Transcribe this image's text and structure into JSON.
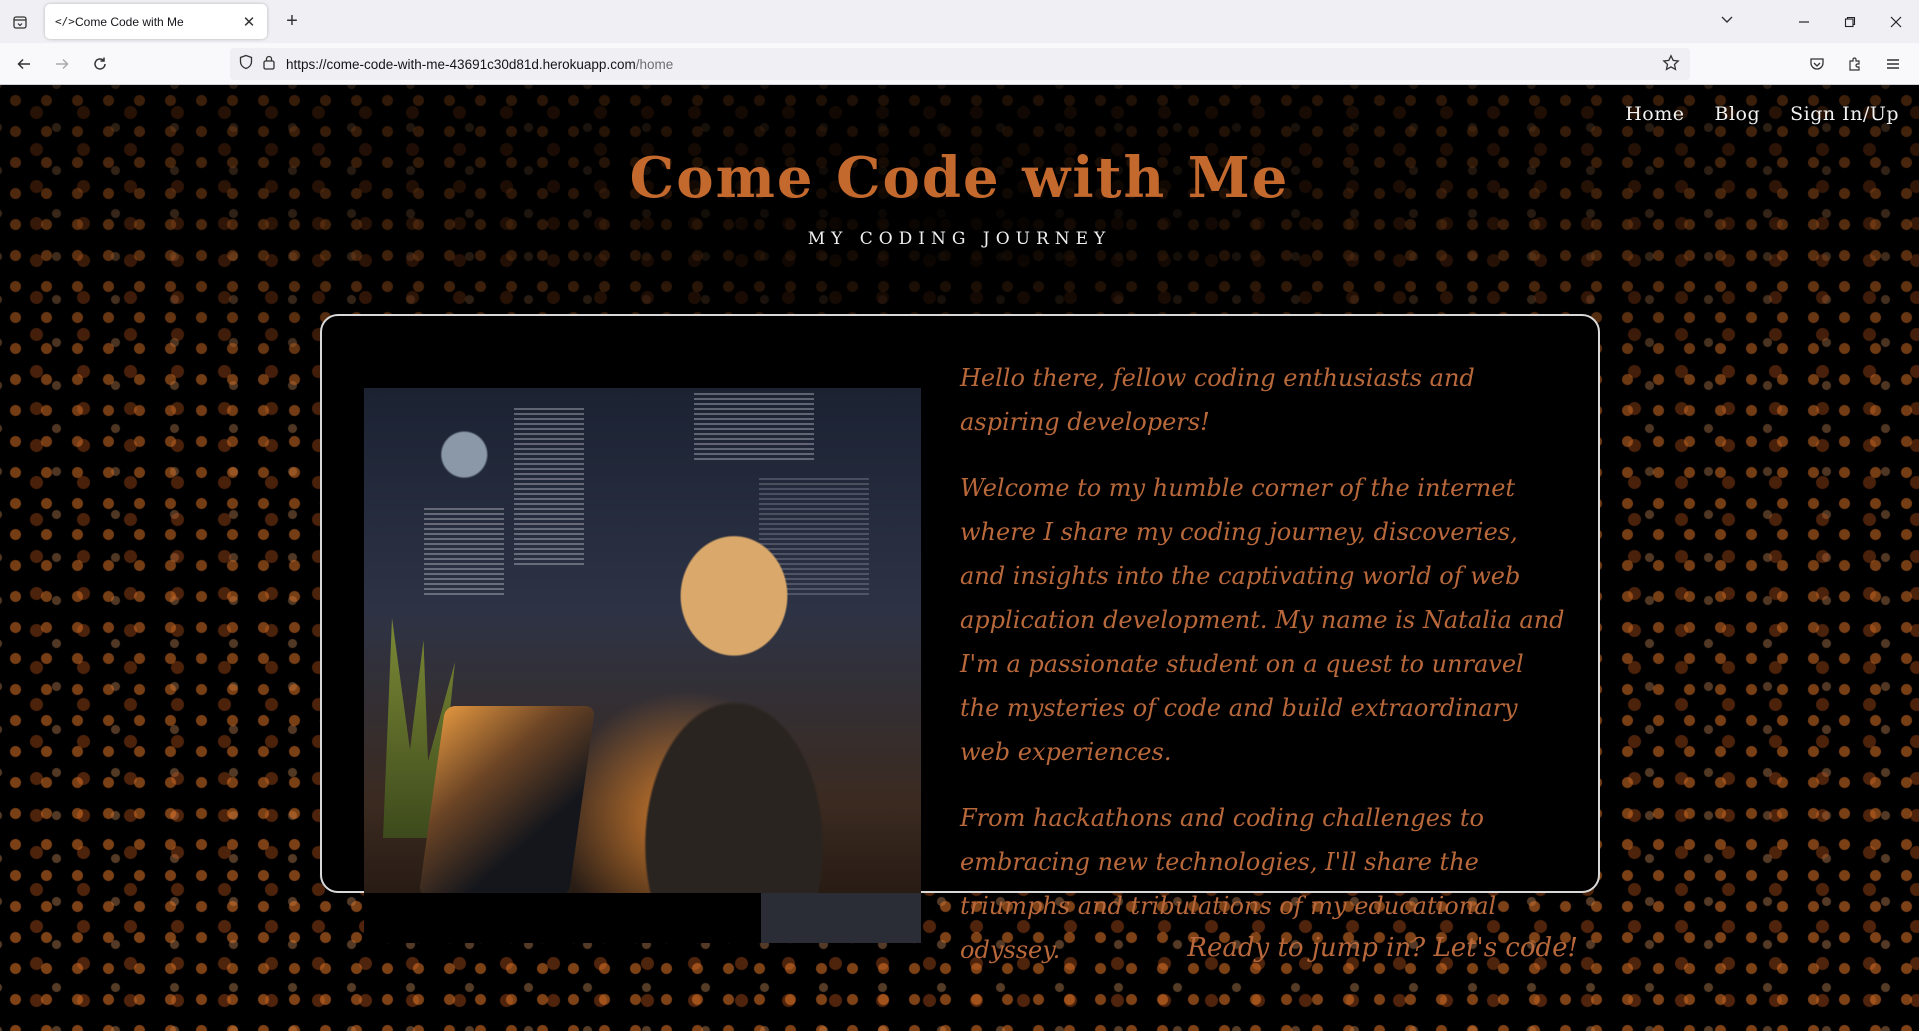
{
  "browser": {
    "tab_title": "Come Code with Me",
    "tab_icon": "</>",
    "url_main": "https://come-code-with-me-43691c30d81d.herokuapp.com",
    "url_path": "/home"
  },
  "site": {
    "nav": [
      "Home",
      "Blog",
      "Sign In/Up"
    ],
    "title": "Come Code with Me",
    "subtitle": "MY CODING JOURNEY"
  },
  "card": {
    "paragraphs": [
      "Hello there, fellow coding enthusiasts and aspiring developers!",
      "Welcome to my humble corner of the internet where I share my coding journey, discoveries, and insights into the captivating world of web application development. My name is Natalia and I'm a passionate student on a quest to unravel the mysteries of code and build extraordinary web experiences.",
      "From hackathons and coding challenges to embracing new technologies, I'll share the triumphs and tribulations of my educational odyssey."
    ],
    "cta": "Ready to jump in? Let's code!"
  },
  "colors": {
    "accent": "#c4692e",
    "text_script": "#b8683a",
    "background": "#000000"
  }
}
